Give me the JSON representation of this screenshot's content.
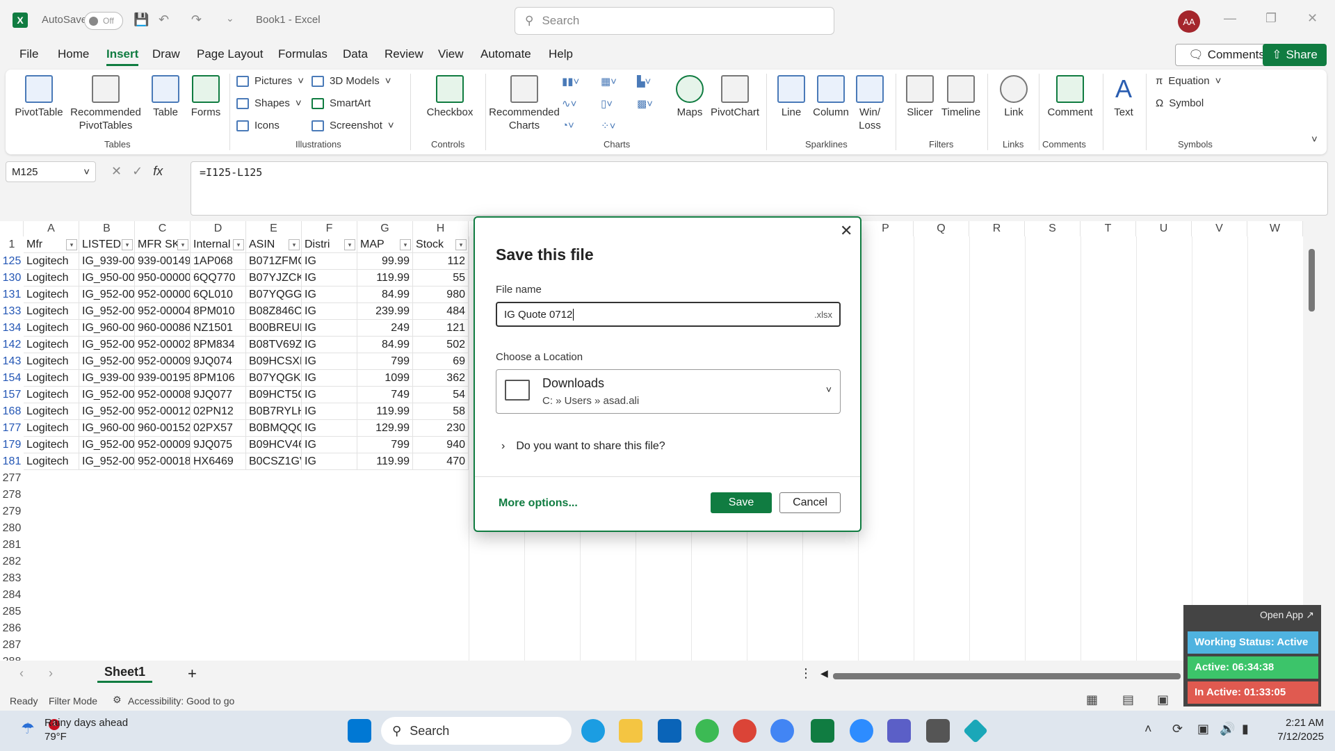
{
  "title_bar": {
    "autosave_label": "AutoSave",
    "autosave_state": "Off",
    "doc_title": "Book1 - Excel",
    "search_placeholder": "Search",
    "avatar_initials": "AA"
  },
  "menu": {
    "items": [
      "File",
      "Home",
      "Insert",
      "Draw",
      "Page Layout",
      "Formulas",
      "Data",
      "Review",
      "View",
      "Automate",
      "Help"
    ],
    "active": "Insert",
    "comments_label": "Comments",
    "share_label": "Share"
  },
  "ribbon": {
    "tables": {
      "label": "Tables",
      "pivot": "PivotTable",
      "rec_pivot": "Recommended PivotTables",
      "table": "Table",
      "forms": "Forms"
    },
    "illustrations": {
      "label": "Illustrations",
      "pictures": "Pictures",
      "shapes": "Shapes",
      "icons": "Icons",
      "models": "3D Models",
      "smartart": "SmartArt",
      "screenshot": "Screenshot"
    },
    "controls": {
      "label": "Controls",
      "checkbox": "Checkbox"
    },
    "charts": {
      "label": "Charts",
      "rec_charts": "Recommended Charts",
      "maps": "Maps",
      "pivotchart": "PivotChart"
    },
    "sparklines": {
      "label": "Sparklines",
      "line": "Line",
      "column": "Column",
      "winloss": "Win/ Loss"
    },
    "filters": {
      "label": "Filters",
      "slicer": "Slicer",
      "timeline": "Timeline"
    },
    "links": {
      "label": "Links",
      "link": "Link"
    },
    "comments": {
      "label": "Comments",
      "comment": "Comment"
    },
    "text": {
      "text": "Text"
    },
    "symbols": {
      "label": "Symbols",
      "equation": "Equation",
      "symbol": "Symbol"
    }
  },
  "formula_bar": {
    "name_box": "M125",
    "formula": "=I125-L125"
  },
  "sheet": {
    "columns": [
      "A",
      "B",
      "C",
      "D",
      "E",
      "F",
      "G",
      "H",
      "P",
      "Q",
      "R",
      "S",
      "T",
      "U",
      "V",
      "W"
    ],
    "header_row": {
      "row": "1",
      "cells": [
        "Mfr",
        "LISTED S",
        "MFR SKU",
        "Internal",
        "ASIN",
        "Distri",
        "MAP",
        "Stock"
      ]
    },
    "rows": [
      {
        "row": "125",
        "cells": [
          "Logitech",
          "IG_939-00",
          "939-00149",
          "1AP068",
          "B071ZFMC",
          "IG",
          "99.99",
          "112"
        ]
      },
      {
        "row": "130",
        "cells": [
          "Logitech",
          "IG_950-00",
          "950-00000",
          "6QQ770",
          "B07YJZCKI",
          "IG",
          "119.99",
          "55"
        ]
      },
      {
        "row": "131",
        "cells": [
          "Logitech",
          "IG_952-00",
          "952-00000",
          "6QL010",
          "B07YQGGI",
          "IG",
          "84.99",
          "980"
        ]
      },
      {
        "row": "133",
        "cells": [
          "Logitech",
          "IG_952-00",
          "952-00004",
          "8PM010",
          "B08Z846C",
          "IG",
          "239.99",
          "484"
        ]
      },
      {
        "row": "134",
        "cells": [
          "Logitech",
          "IG_960-00",
          "960-00086",
          "NZ1501",
          "B00BREUB",
          "IG",
          "249",
          "121"
        ]
      },
      {
        "row": "142",
        "cells": [
          "Logitech",
          "IG_952-00",
          "952-00002",
          "8PM834",
          "B08TV69ZI",
          "IG",
          "84.99",
          "502"
        ]
      },
      {
        "row": "143",
        "cells": [
          "Logitech",
          "IG_952-00",
          "952-00009",
          "9JQ074",
          "B09HCSXH",
          "IG",
          "799",
          "69"
        ]
      },
      {
        "row": "154",
        "cells": [
          "Logitech",
          "IG_939-00",
          "939-00195",
          "8PM106",
          "B07YQGK4",
          "IG",
          "1099",
          "362"
        ]
      },
      {
        "row": "157",
        "cells": [
          "Logitech",
          "IG_952-00",
          "952-00008",
          "9JQ077",
          "B09HCT5C",
          "IG",
          "749",
          "54"
        ]
      },
      {
        "row": "168",
        "cells": [
          "Logitech",
          "IG_952-00",
          "952-00012",
          "02PN12",
          "B0B7RYLH",
          "IG",
          "119.99",
          "58"
        ]
      },
      {
        "row": "177",
        "cells": [
          "Logitech",
          "IG_960-00",
          "960-00152",
          "02PX57",
          "B0BMQQQ",
          "IG",
          "129.99",
          "230"
        ]
      },
      {
        "row": "179",
        "cells": [
          "Logitech",
          "IG_952-00",
          "952-00009",
          "9JQ075",
          "B09HCV46",
          "IG",
          "799",
          "940"
        ]
      },
      {
        "row": "181",
        "cells": [
          "Logitech",
          "IG_952-00",
          "952-00018",
          "HX6469",
          "B0CSZ1GV",
          "IG",
          "119.99",
          "470"
        ]
      }
    ],
    "empty_rows": [
      "277",
      "278",
      "279",
      "280",
      "281",
      "282",
      "283",
      "284",
      "285",
      "286",
      "287",
      "288"
    ],
    "tab": "Sheet1"
  },
  "status_bar": {
    "ready": "Ready",
    "filter_mode": "Filter Mode",
    "accessibility": "Accessibility: Good to go"
  },
  "dialog": {
    "title": "Save this file",
    "file_name_label": "File name",
    "file_name_value": "IG Quote 0712",
    "extension": ".xlsx",
    "location_label": "Choose a Location",
    "location_name": "Downloads",
    "location_path": "C: » Users » asad.ali",
    "share_question": "Do you want to share this file?",
    "more_options": "More options...",
    "save": "Save",
    "cancel": "Cancel"
  },
  "tracker": {
    "open_app": "Open App ↗",
    "status": "Working Status: Active",
    "active": "Active: 06:34:38",
    "inactive": "In Active: 01:33:05",
    "status_color": "#4fb3e0",
    "active_color": "#3cc46a",
    "inactive_color": "#e05a50"
  },
  "taskbar": {
    "weather_badge": "1",
    "weather_title": "Rainy days ahead",
    "weather_temp": "79°F",
    "search_label": "Search",
    "time": "2:21 AM",
    "date": "7/12/2025"
  }
}
